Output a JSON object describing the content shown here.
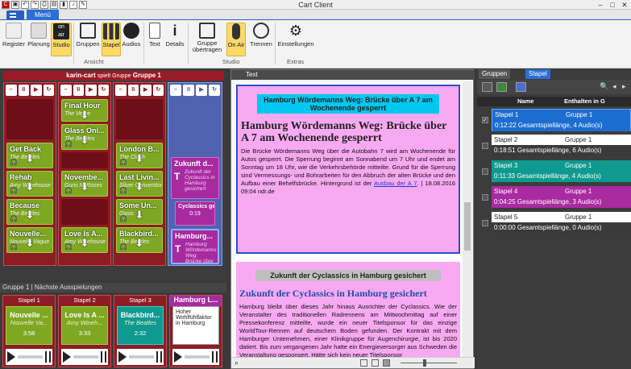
{
  "window": {
    "title": "Cart Client"
  },
  "ribbon": {
    "menu_label": "Menü",
    "buttons": {
      "register": "Register",
      "planung": "Planung",
      "studio": "Studio",
      "gruppen": "Gruppen",
      "stapel": "Stapel",
      "audios": "Audios",
      "text": "Text",
      "details": "Details",
      "gruppe_uebertragen": "Gruppe übertragen",
      "on_air": "On Air",
      "trennen": "Trennen",
      "einstellungen": "Einstellungen"
    },
    "groups": {
      "ansicht": "Ansicht",
      "studio": "Studio",
      "extras": "Extras"
    }
  },
  "cart": {
    "user": "karin-cart",
    "spielt": "spielt Gruppe",
    "gruppe": "Gruppe 1",
    "controls": [
      "–",
      "II",
      "▶",
      "↻"
    ],
    "col1": [],
    "col2": [
      {
        "title": "Final Hour",
        "sub": "The Verve"
      },
      {
        "title": "Glass Oni...",
        "sub": "The Beatles"
      },
      {
        "title": "Novembe...",
        "sub": "Guns N' Roses"
      },
      {
        "title": "Love Is A...",
        "sub": "Amy Winehouse"
      }
    ],
    "col0": [
      {
        "title": "Get Back",
        "sub": "The Beatles"
      },
      {
        "title": "Rehab",
        "sub": "Amy Winehouse"
      },
      {
        "title": "Because",
        "sub": "The Beatles"
      },
      {
        "title": "Nouvelle...",
        "sub": "Nouvelle Vague"
      }
    ],
    "col3": [
      {
        "title": "London B...",
        "sub": "The Clash"
      },
      {
        "title": "Last Livin...",
        "sub": "Silver Convention"
      },
      {
        "title": "Some Un...",
        "sub": "Oasis"
      },
      {
        "title": "Blackbird...",
        "sub": "The Beatles"
      }
    ],
    "col4": [
      {
        "title": "Zukunft d...",
        "text": "Zukunft der Cyclassics in Hamburg gesichert"
      },
      {
        "title": "Cyclassics geh...",
        "time": "0:19"
      },
      {
        "title": "Hamburg...",
        "text": "Hamburg Wördemanns Weg: Brücke über A 7..."
      }
    ]
  },
  "next": {
    "group_label": "Gruppe 1",
    "tab_label": "Nächste Ausspielungen",
    "items": [
      {
        "stapel": "Stapel 1",
        "title": "Nouvelle ...",
        "artist": "Nouvelle Va...",
        "time": "3:58"
      },
      {
        "stapel": "Stapel 2",
        "title": "Love Is A ...",
        "artist": "Amy Wineh...",
        "time": "3:33"
      },
      {
        "stapel": "Stapel 3",
        "title": "Blackbird...",
        "artist": "The Beatles",
        "time": "2:32"
      },
      {
        "stapel": "Stapel 4",
        "title": "Hamburg L...",
        "text": "Hoher Wohlfühlfaktor in Hamburg"
      }
    ]
  },
  "text_panel": {
    "tab_label": "Text",
    "article1": {
      "box": "Hamburg Wördemanns Weg: Brücke über A 7 am Wochenende gesperrt",
      "headline": "Hamburg Wördemanns Weg: Brücke über A 7 am Wochenende gesperrt",
      "body": "Die Brücke Wördemanns Weg über die Autobahn 7 wird am Wochenende für Autos gesperrt. Die Sperrung beginnt am Sonnabend um 7 Uhr und endet am Sonntag um 18 Uhr, wie die Verkehrsbehörde mitteilte. Grund für die Sperrung sind Vermessungs- und Bohrarbeiten für den Abbruch der alten Brücke und den Aufbau einer Behelfsbrücke. Hintergrund ist der ",
      "link": "Ausbau der A 7",
      "tail": ". | 18.08.2016 09:04 ndr.de"
    },
    "article2": {
      "box": "Zukunft der Cyclassics in Hamburg gesichert",
      "headline": "Zukunft der Cyclassics in Hamburg gesichert",
      "body": "Hamburg bleibt über dieses Jahr hinaus Ausrichter der Cyclassics. Wie der Veranstalter des traditionellen Radrennens am Mittwochmittag auf einer Pressekonferenz mitteilte, wurde ein neuer Titelsponsor für das einzige WorldTour-Rennen auf deutschem Boden gefunden. Der Kontrakt mit dem Hamburger Unternehmen, einer Klinikgruppe für Augenchirurgie, ist bis 2020 datiert. Bis zum vergangenen Jahr hatte ein Energieversorger aus Schweden die Veranstaltung gesponsert. Hätte sich kein neuer Titelsponsor"
    }
  },
  "right_panel": {
    "tabs": [
      "Gruppen",
      "Stapel"
    ],
    "columns": [
      "Name",
      "Enthalten in G"
    ],
    "rows": [
      {
        "name": "Stapel 1",
        "gruppe": "Gruppe 1",
        "info": "0:12:22 Gesamtspiellänge, 4 Audio(s)",
        "color": "#1c6dd0",
        "checked": true
      },
      {
        "name": "Stapel 2",
        "gruppe": "Gruppe 1",
        "info": "0:18:51 Gesamtspiellänge, 6 Audio(s)",
        "color": "#3a3a3a",
        "checked": false
      },
      {
        "name": "Stapel 3",
        "gruppe": "Gruppe 1",
        "info": "0:11:33 Gesamtspiellänge, 4 Audio(s)",
        "color": "#0e9a8f",
        "checked": false
      },
      {
        "name": "Stapel 4",
        "gruppe": "Gruppe 1",
        "info": "0:04:25 Gesamtspiellänge, 3 Audio(s)",
        "color": "#a92aa1",
        "checked": false
      },
      {
        "name": "Stapel 5",
        "gruppe": "Gruppe 1",
        "info": "0:00:00 Gesamtspiellänge, 0 Audio(s)",
        "color": "#3a3a3a",
        "checked": false
      }
    ]
  }
}
